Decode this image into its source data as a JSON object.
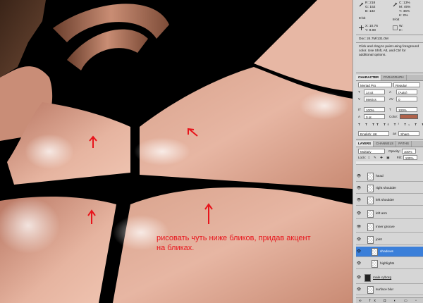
{
  "info": {
    "r_label": "R:",
    "r_value": "218",
    "g_label": "G:",
    "g_value": "152",
    "b_label": "B:",
    "b_value": "132",
    "bit_left": "8-bit",
    "c_label": "C:",
    "c_value": "13%",
    "m_label": "M:",
    "m_value": "45%",
    "y_label": "Y:",
    "y_value": "46%",
    "k_label": "K:",
    "k_value": "0%",
    "bit_right": "8-bit",
    "x_label": "X:",
    "x_value": "10.76",
    "ypos_label": "Y:",
    "ypos_value": "9.08",
    "w_label": "W:",
    "h_label": "H:",
    "doc": "Doc: 24.7M/131.0M",
    "hint": "Click and drag to paint using foreground color.  Use Shift, Alt, and Ctrl for additional options."
  },
  "character": {
    "tab_character": "CHARACTER",
    "tab_paragraph": "PARAGRAPH",
    "font_family": "Myriad Pro",
    "font_style": "Regular",
    "font_size": "14 pt",
    "leading": "(Auto)",
    "kerning": "Metrics",
    "tracking": "0",
    "vscale": "100%",
    "hscale": "100%",
    "baseline": "0 pt",
    "color_label": "Color:",
    "color": "#b0624a",
    "language": "English: UK",
    "aa_label": "aa",
    "antialias": "Sharp"
  },
  "layers_panel": {
    "tab_layers": "LAYERS",
    "tab_channels": "CHANNELS",
    "tab_paths": "PATHS",
    "blend_mode": "Multiply",
    "opacity_label": "Opacity:",
    "opacity": "100%",
    "lock_label": "Lock:",
    "fill_label": "Fill:",
    "fill": "100%",
    "layers": [
      {
        "name": "head"
      },
      {
        "name": "right shoulder"
      },
      {
        "name": "left shoulder"
      },
      {
        "name": "left arm"
      },
      {
        "name": "inner groove"
      },
      {
        "name": "joint"
      },
      {
        "name": "shadows"
      },
      {
        "name": "highlights"
      },
      {
        "name": "male cyborg"
      },
      {
        "name": "surface blur"
      }
    ]
  },
  "annotation": {
    "text_line1": "рисовать чуть ниже бликов, придав акцент",
    "text_line2": "на  бликах."
  }
}
